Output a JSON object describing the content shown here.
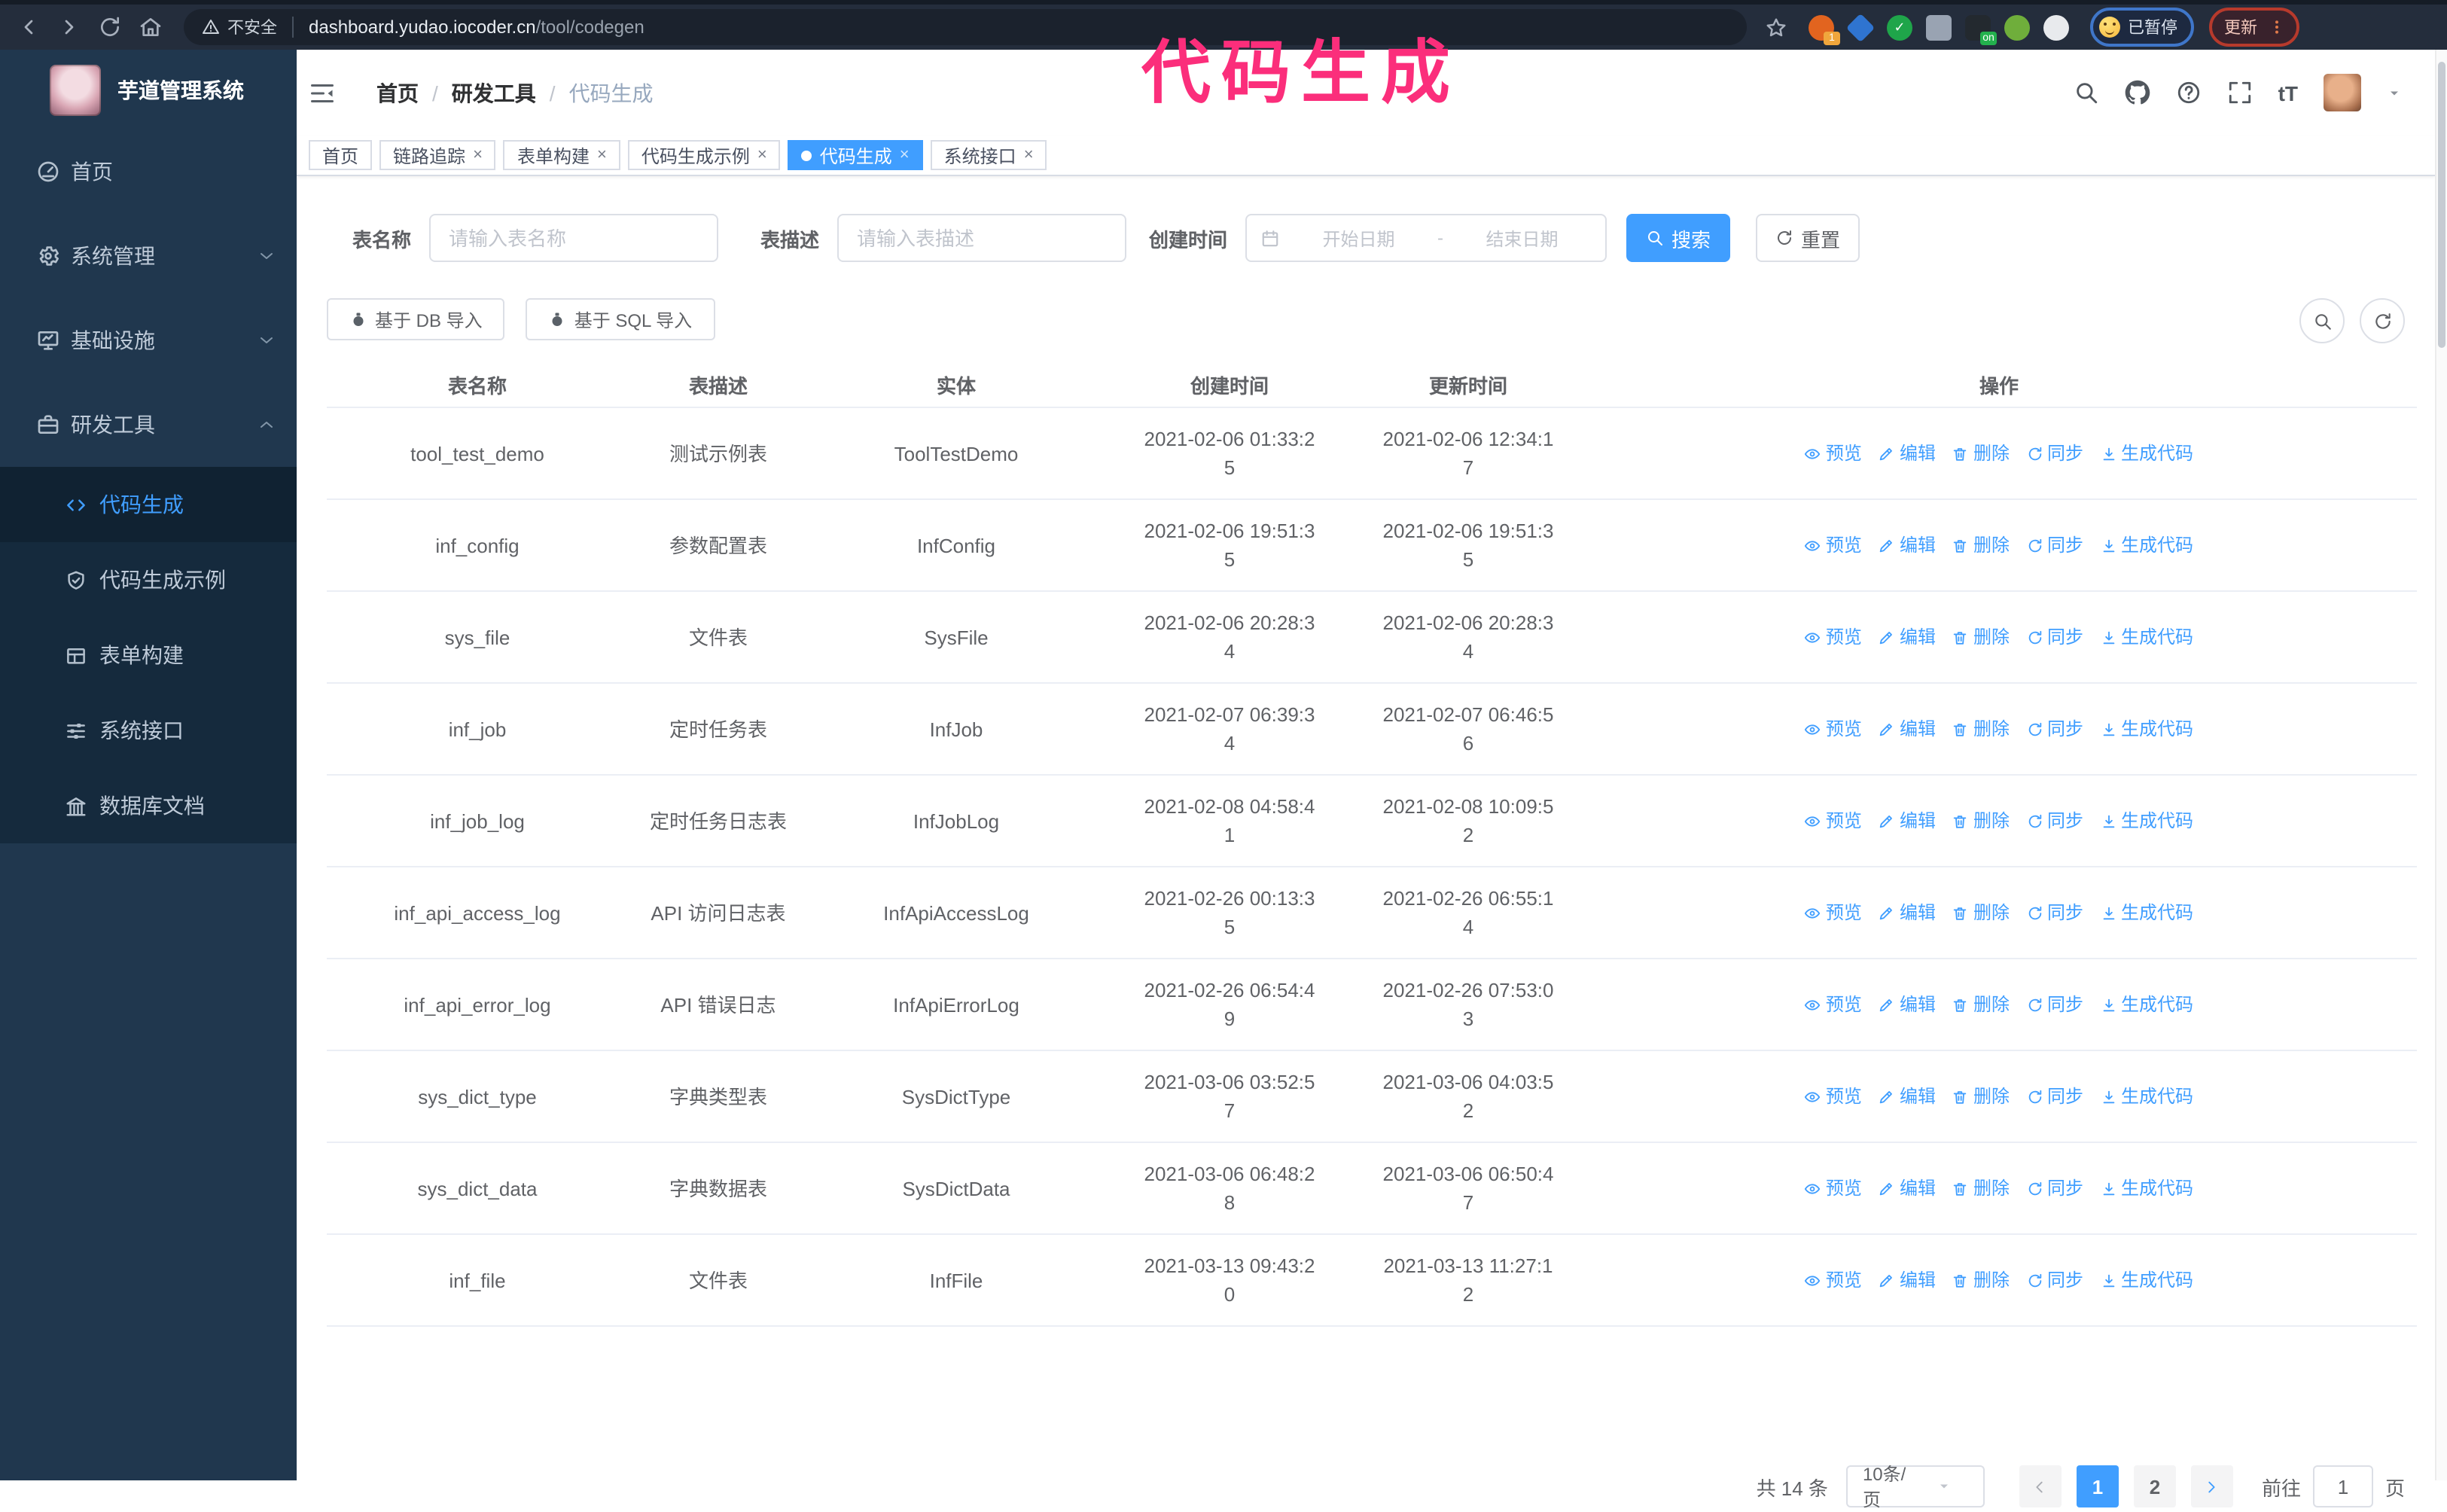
{
  "browser": {
    "warning": "不安全",
    "url_host": "dashboard.yudao.iocoder.cn",
    "url_path": "/tool/codegen",
    "paused_label": "已暂停",
    "update_label": "更新",
    "extensions": [
      {
        "name": "ext-orange",
        "color": "#e2641f",
        "badge": "1",
        "badge_color": "#f0a63c",
        "shape": "circle"
      },
      {
        "name": "ext-gem",
        "color": "#2f74d0",
        "shape": "diamond"
      },
      {
        "name": "ext-green-check",
        "color": "#1fa54a",
        "glyph": "✓",
        "shape": "circle"
      },
      {
        "name": "ext-grid",
        "color": "#99a3b2",
        "shape": "grid"
      },
      {
        "name": "ext-dark-on",
        "color": "#23292f",
        "badge": "on",
        "badge_color": "#23b14d",
        "shape": "square"
      },
      {
        "name": "ext-bot",
        "color": "#6fae3b",
        "shape": "circle"
      },
      {
        "name": "ext-ghost",
        "color": "#e8eaed",
        "shape": "circle"
      }
    ]
  },
  "annotation": {
    "text": "代码生成",
    "color": "#fb2e7b"
  },
  "sidebar": {
    "logo_title": "芋道管理系统",
    "menu": [
      {
        "label": "首页",
        "icon": "dashboard",
        "chevron": null
      },
      {
        "label": "系统管理",
        "icon": "gear",
        "chevron": "down"
      },
      {
        "label": "基础设施",
        "icon": "monitor",
        "chevron": "down"
      },
      {
        "label": "研发工具",
        "icon": "toolbox",
        "chevron": "up"
      }
    ],
    "submenu": [
      {
        "label": "代码生成",
        "icon": "code",
        "active": true
      },
      {
        "label": "代码生成示例",
        "icon": "shield",
        "active": false
      },
      {
        "label": "表单构建",
        "icon": "form",
        "active": false
      },
      {
        "label": "系统接口",
        "icon": "sliders",
        "active": false
      },
      {
        "label": "数据库文档",
        "icon": "columns",
        "active": false
      }
    ]
  },
  "header": {
    "breadcrumb": [
      "首页",
      "研发工具",
      "代码生成"
    ],
    "text_size_label": "tT"
  },
  "tabs": [
    {
      "label": "首页",
      "closable": false,
      "active": false
    },
    {
      "label": "链路追踪",
      "closable": true,
      "active": false
    },
    {
      "label": "表单构建",
      "closable": true,
      "active": false
    },
    {
      "label": "代码生成示例",
      "closable": true,
      "active": false
    },
    {
      "label": "代码生成",
      "closable": true,
      "active": true
    },
    {
      "label": "系统接口",
      "closable": true,
      "active": false
    }
  ],
  "filters": {
    "name_label": "表名称",
    "name_placeholder": "请输入表名称",
    "desc_label": "表描述",
    "desc_placeholder": "请输入表描述",
    "time_label": "创建时间",
    "date_start_placeholder": "开始日期",
    "date_separator": "-",
    "date_end_placeholder": "结束日期",
    "search_label": "搜索",
    "reset_label": "重置"
  },
  "toolbar": {
    "db_import_label": "基于 DB 导入",
    "sql_import_label": "基于 SQL 导入"
  },
  "table": {
    "columns": [
      "表名称",
      "表描述",
      "实体",
      "创建时间",
      "更新时间",
      "操作"
    ],
    "actions": [
      {
        "label": "预览",
        "icon": "eye"
      },
      {
        "label": "编辑",
        "icon": "edit"
      },
      {
        "label": "删除",
        "icon": "trash"
      },
      {
        "label": "同步",
        "icon": "sync"
      },
      {
        "label": "生成代码",
        "icon": "download"
      }
    ],
    "rows": [
      {
        "name": "tool_test_demo",
        "desc": "测试示例表",
        "entity": "ToolTestDemo",
        "created": "2021-02-06 01:33:25",
        "updated": "2021-02-06 12:34:17"
      },
      {
        "name": "inf_config",
        "desc": "参数配置表",
        "entity": "InfConfig",
        "created": "2021-02-06 19:51:35",
        "updated": "2021-02-06 19:51:35"
      },
      {
        "name": "sys_file",
        "desc": "文件表",
        "entity": "SysFile",
        "created": "2021-02-06 20:28:34",
        "updated": "2021-02-06 20:28:34"
      },
      {
        "name": "inf_job",
        "desc": "定时任务表",
        "entity": "InfJob",
        "created": "2021-02-07 06:39:34",
        "updated": "2021-02-07 06:46:56"
      },
      {
        "name": "inf_job_log",
        "desc": "定时任务日志表",
        "entity": "InfJobLog",
        "created": "2021-02-08 04:58:41",
        "updated": "2021-02-08 10:09:52"
      },
      {
        "name": "inf_api_access_log",
        "desc": "API 访问日志表",
        "entity": "InfApiAccessLog",
        "created": "2021-02-26 00:13:35",
        "updated": "2021-02-26 06:55:14"
      },
      {
        "name": "inf_api_error_log",
        "desc": "API 错误日志",
        "entity": "InfApiErrorLog",
        "created": "2021-02-26 06:54:49",
        "updated": "2021-02-26 07:53:03"
      },
      {
        "name": "sys_dict_type",
        "desc": "字典类型表",
        "entity": "SysDictType",
        "created": "2021-03-06 03:52:57",
        "updated": "2021-03-06 04:03:52"
      },
      {
        "name": "sys_dict_data",
        "desc": "字典数据表",
        "entity": "SysDictData",
        "created": "2021-03-06 06:48:28",
        "updated": "2021-03-06 06:50:47"
      },
      {
        "name": "inf_file",
        "desc": "文件表",
        "entity": "InfFile",
        "created": "2021-03-13 09:43:20",
        "updated": "2021-03-13 11:27:12"
      }
    ]
  },
  "pagination": {
    "total": "共 14 条",
    "page_size": "10条/页",
    "pages": [
      {
        "label": "1",
        "active": true
      },
      {
        "label": "2",
        "active": false
      }
    ],
    "goto_label": "前往",
    "goto_value": "1",
    "unit_label": "页"
  },
  "colors": {
    "accent": "#409eff",
    "sidebar_bg": "#20374e",
    "submenu_bg": "#152a3d",
    "annotation_pink": "#fb2e7b"
  }
}
